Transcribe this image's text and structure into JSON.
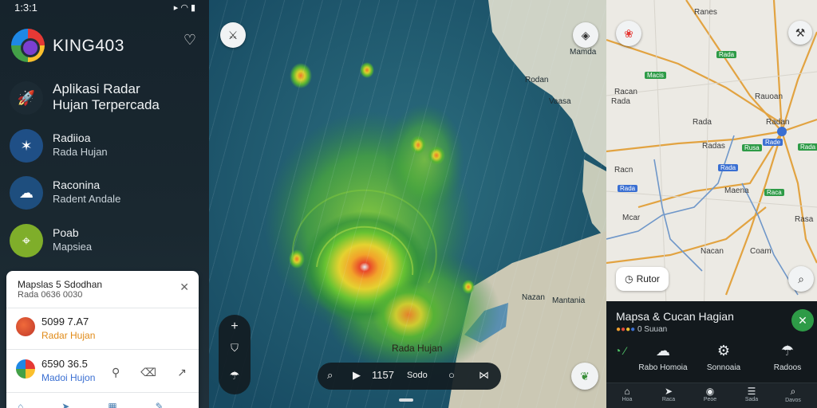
{
  "status_bar": {
    "time": "1:3:1",
    "icons": [
      "signal-icon",
      "wifi-icon",
      "battery-icon"
    ]
  },
  "brand": {
    "name": "KING403"
  },
  "menu": [
    {
      "title": "Aplikasi Radar",
      "subtitle": "Hujan Terpercada",
      "icon": "rocket-icon",
      "color": "#1c2a33"
    },
    {
      "title": "Radiioa",
      "subtitle": "Rada Hujan",
      "icon": "radar-icon",
      "color": "#1f4f86"
    },
    {
      "title": "Raconina",
      "subtitle": "Radent Andale",
      "icon": "storm-icon",
      "color": "#1e4e7e"
    },
    {
      "title": "Poab",
      "subtitle": "Mapsiea",
      "icon": "map-icon",
      "color": "#7fae2a"
    }
  ],
  "card": {
    "title": "Mapslas 5 Sdodhan",
    "subtitle": "Rada 0636 0030",
    "rows": [
      {
        "value": "5099 7.A7",
        "label": "Radar Hujan",
        "label_color": "#e08a17",
        "icon": "location-pin-icon"
      },
      {
        "value": "6590 36.5",
        "label": "Madoi Hujon",
        "label_color": "#3a6fd2",
        "icon": "globe-icon"
      }
    ],
    "row_actions": [
      "share-icon",
      "delete-icon",
      "arrow-icon"
    ],
    "footer_icons": [
      "home-icon",
      "send-icon",
      "grid-icon",
      "edit-icon"
    ]
  },
  "radar": {
    "labels": [
      {
        "text": "Mamda"
      },
      {
        "text": "Rodan"
      },
      {
        "text": "Vaasa"
      },
      {
        "text": "Nazan"
      },
      {
        "text": "Mantania"
      },
      {
        "text": "Rada Hujan"
      }
    ],
    "player": {
      "time": "1157",
      "label": "Sodo"
    }
  },
  "right_map": {
    "labels": [
      {
        "text": "Ranes"
      },
      {
        "text": "Racan"
      },
      {
        "text": "Rada"
      },
      {
        "text": "Rada"
      },
      {
        "text": "Radan"
      },
      {
        "text": "Radas"
      },
      {
        "text": "Rauoan"
      },
      {
        "text": "Maena"
      },
      {
        "text": "Mcar"
      },
      {
        "text": "Nacan"
      },
      {
        "text": "Coam"
      },
      {
        "text": "Racn"
      },
      {
        "text": "Rasa"
      }
    ],
    "badges": [
      "Rada",
      "Macis",
      "Rusa",
      "Rade",
      "Rada",
      "Raca",
      "Rada",
      "Rada"
    ],
    "chip": "Rutor"
  },
  "sheet": {
    "title": "Mapsa & Cucan Hagian",
    "subtitle": "0 Suuan",
    "actions": [
      {
        "label": "Rabo Homoia",
        "icon": "cloud-icon"
      },
      {
        "label": "Sonnoaia",
        "icon": "gear-icon"
      },
      {
        "label": "Radoos",
        "icon": "storm-icon"
      }
    ],
    "nav": [
      {
        "label": "Hoa",
        "icon": "home-icon"
      },
      {
        "label": "Raca",
        "icon": "send-icon"
      },
      {
        "label": "Peoe",
        "icon": "pin-icon"
      },
      {
        "label": "Sada",
        "icon": "list-icon"
      },
      {
        "label": "Davos",
        "icon": "search-icon"
      }
    ]
  }
}
